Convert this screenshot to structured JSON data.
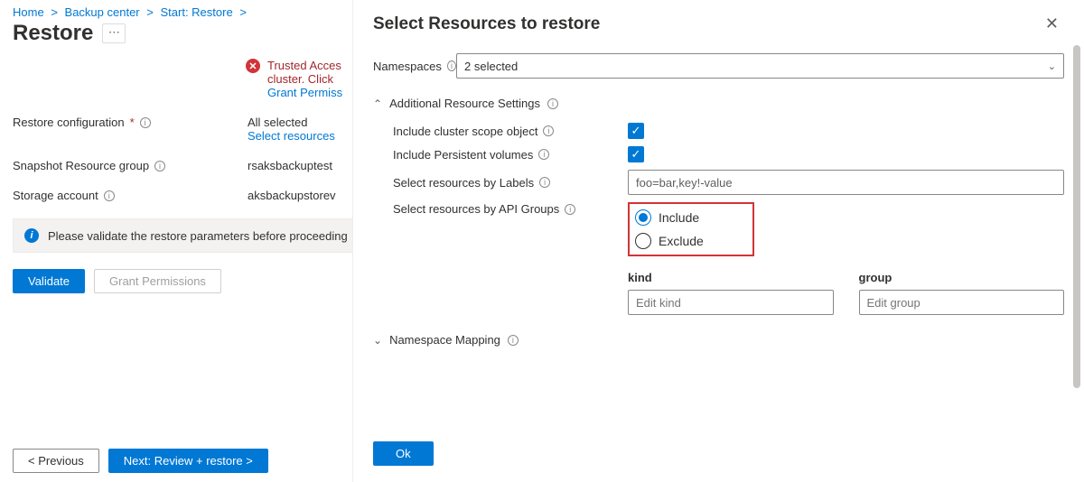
{
  "breadcrumb": {
    "home": "Home",
    "center": "Backup center",
    "start": "Start: Restore"
  },
  "page": {
    "title": "Restore",
    "warning1": "Trusted Acces",
    "warning2": "cluster. Click ",
    "warning3": "Grant Permiss",
    "cfg_label": "Restore configuration",
    "cfg_value": "All selected",
    "cfg_link": "Select resources",
    "snap_label": "Snapshot Resource group",
    "snap_value": "rsaksbackuptest",
    "stor_label": "Storage account",
    "stor_value": "aksbackupstorev",
    "validate_msg": "Please validate the restore parameters before proceeding",
    "validate_btn": "Validate",
    "grant_btn": "Grant Permissions",
    "prev": "< Previous",
    "next": "Next: Review + restore >"
  },
  "panel": {
    "title": "Select Resources to restore",
    "ns_label": "Namespaces",
    "ns_value": "2 selected",
    "ars_title": "Additional Resource Settings",
    "cso_label": "Include cluster scope object",
    "pv_label": "Include Persistent volumes",
    "labels_label": "Select resources by Labels",
    "labels_value": "foo=bar,key!-value",
    "api_label": "Select resources by API Groups",
    "include": "Include",
    "exclude": "Exclude",
    "kind_hdr": "kind",
    "group_hdr": "group",
    "kind_ph": "Edit kind",
    "group_ph": "Edit group",
    "nm_title": "Namespace Mapping",
    "ok": "Ok"
  }
}
